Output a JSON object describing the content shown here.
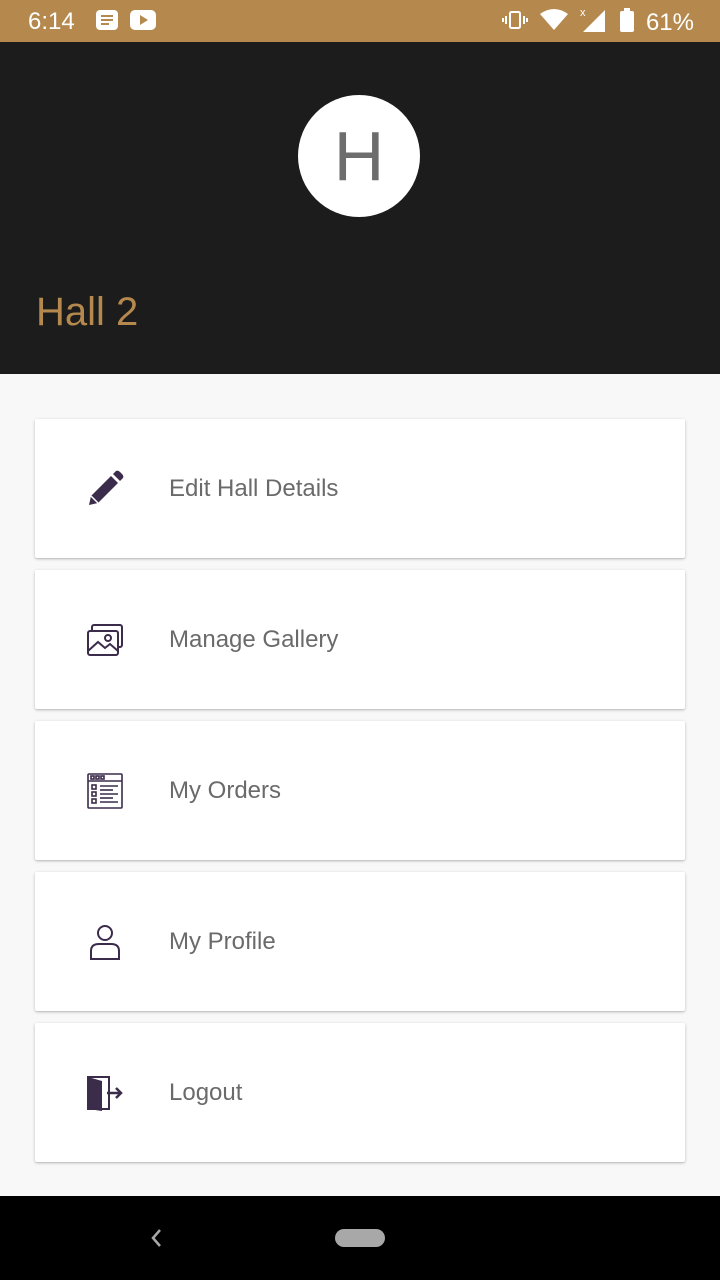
{
  "status_bar": {
    "time": "6:14",
    "battery": "61%",
    "icons": [
      "notes-icon",
      "youtube-icon",
      "vibrate-icon",
      "wifi-icon",
      "signal-icon",
      "battery-icon"
    ],
    "bg_color": "#b5894e"
  },
  "header": {
    "avatar_letter": "H",
    "title": "Hall 2",
    "bg_color": "#1c1c1c",
    "title_color": "#b5894e"
  },
  "menu": {
    "items": [
      {
        "label": "Edit Hall Details",
        "icon": "pencil-icon"
      },
      {
        "label": "Manage Gallery",
        "icon": "gallery-icon"
      },
      {
        "label": "My Orders",
        "icon": "orders-icon"
      },
      {
        "label": "My Profile",
        "icon": "profile-icon"
      },
      {
        "label": "Logout",
        "icon": "logout-icon"
      }
    ],
    "icon_color": "#3b2c4b"
  }
}
